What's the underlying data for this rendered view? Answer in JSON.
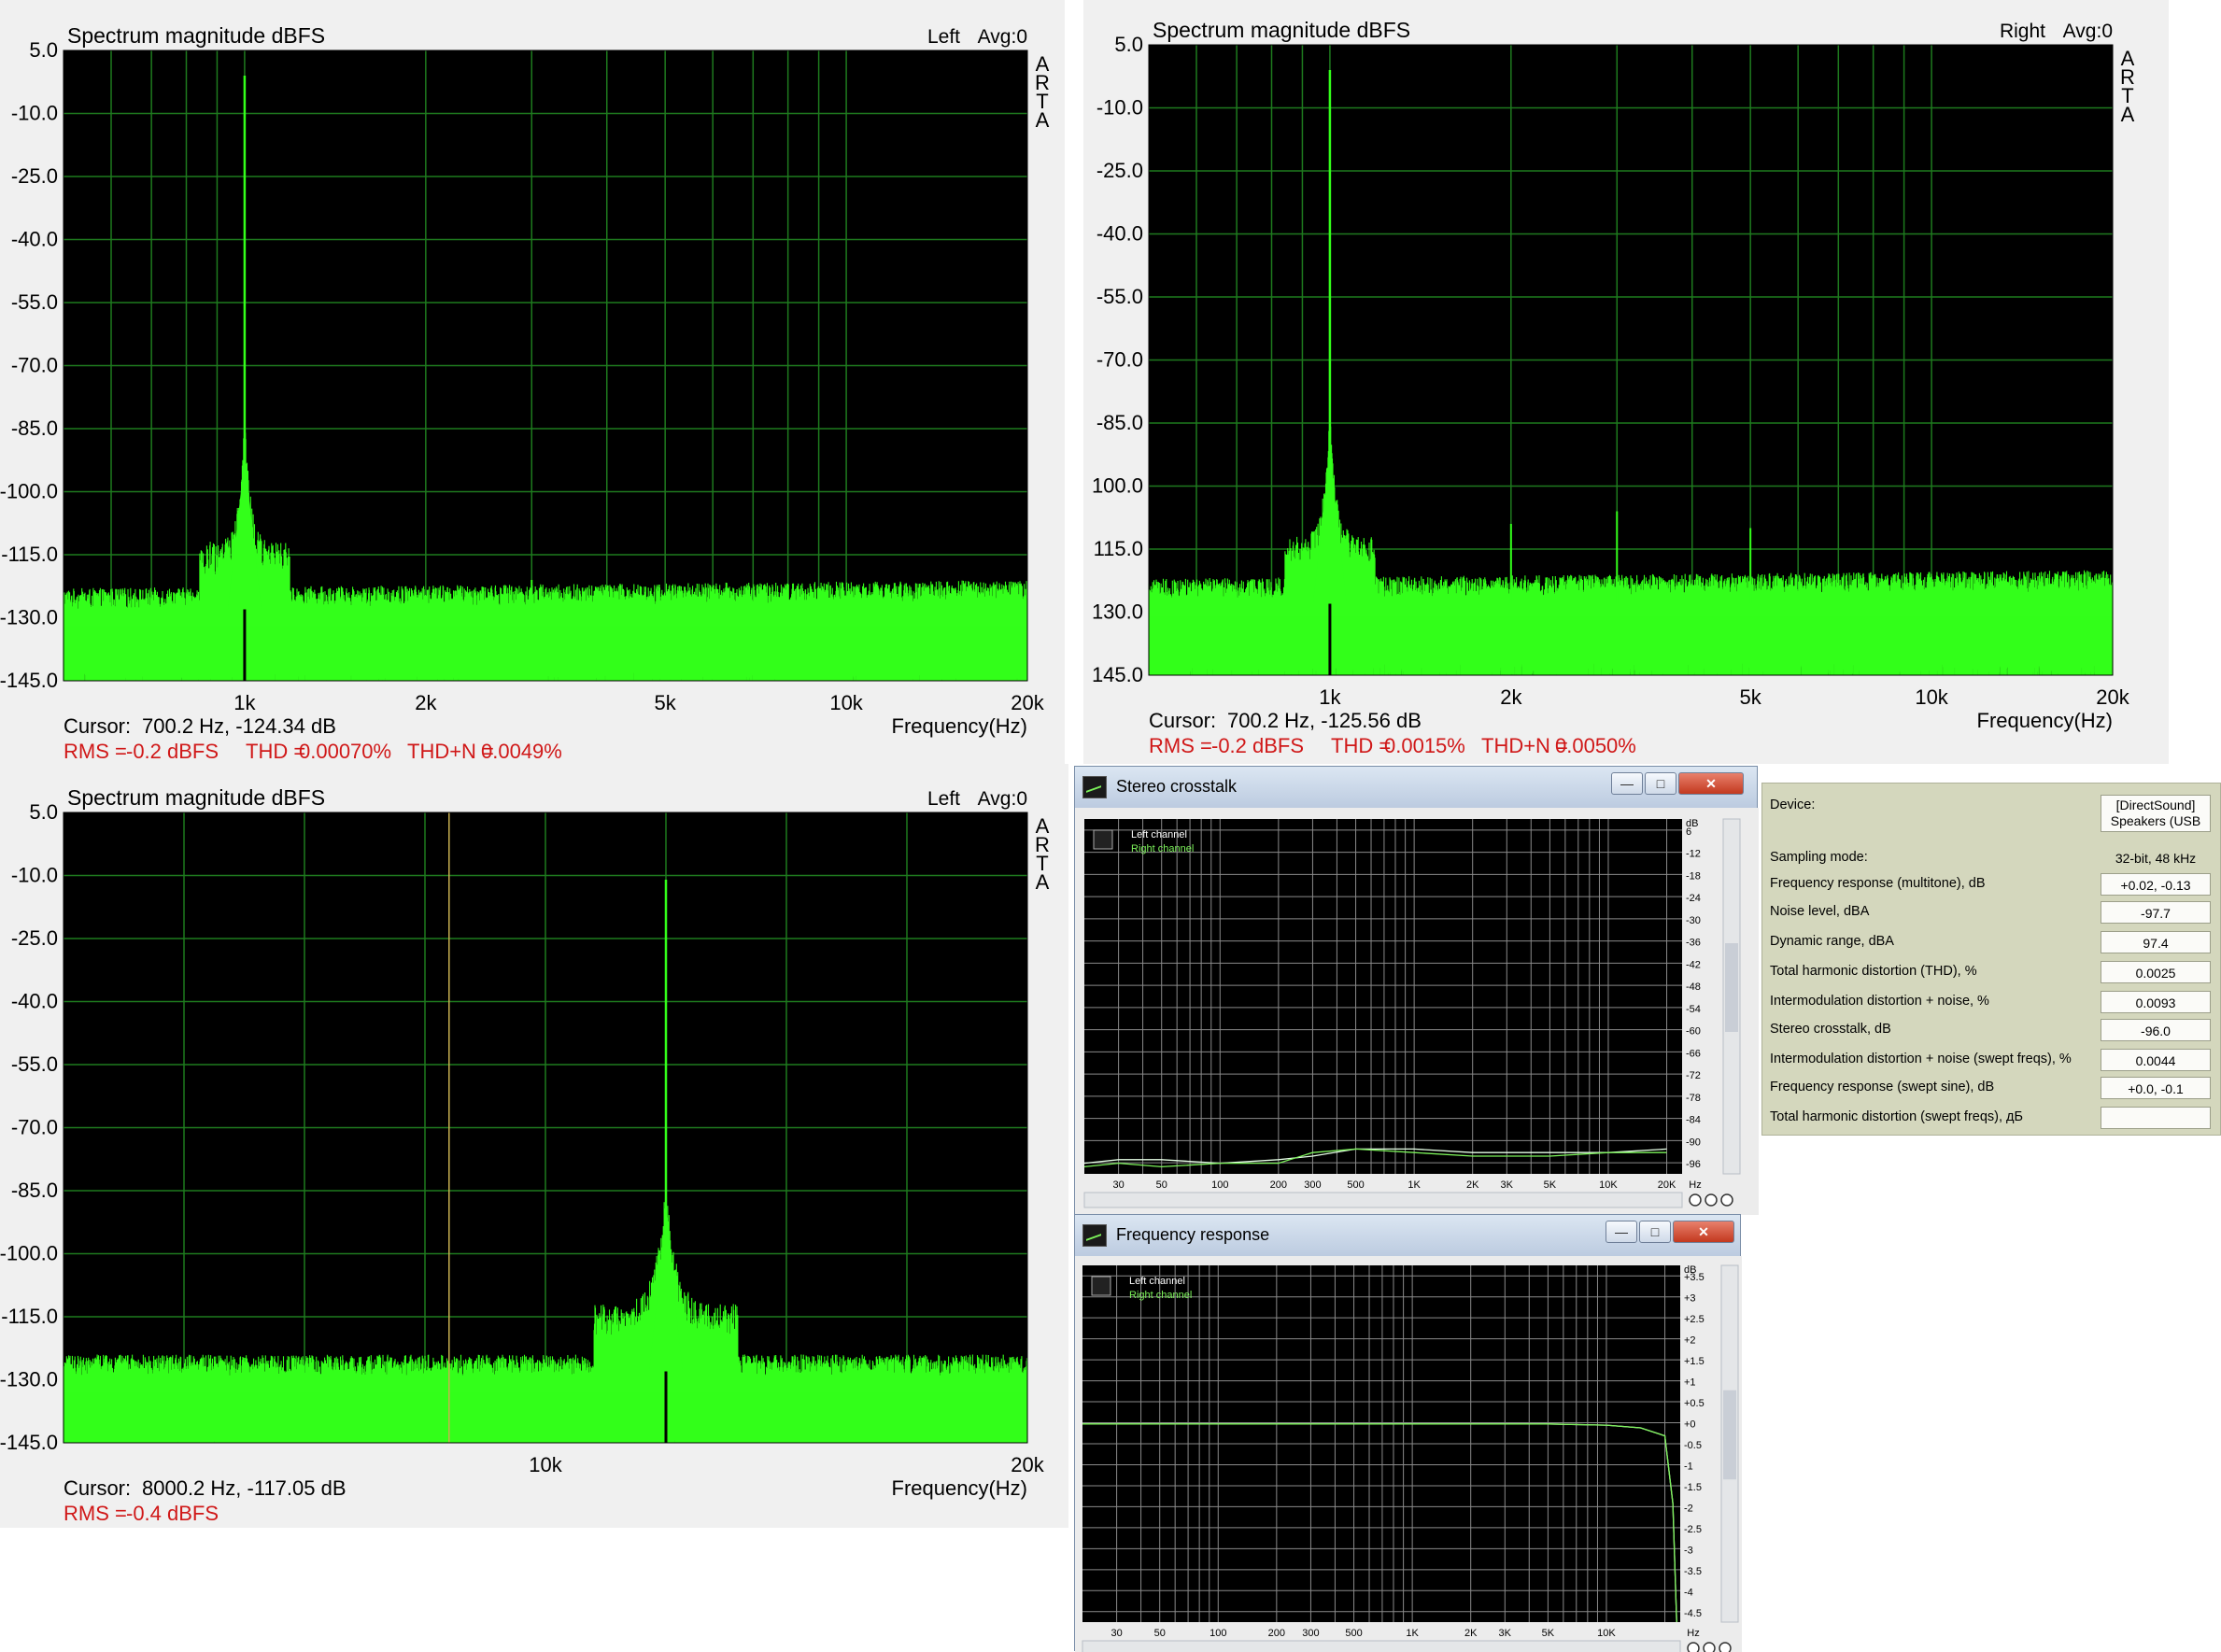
{
  "arta_panels": [
    {
      "title": "Spectrum magnitude dBFS",
      "channel": "Left",
      "avg": "Avg:0",
      "side_label": [
        "A",
        "R",
        "T",
        "A"
      ],
      "cursor_label": "Cursor:",
      "cursor_value": "700.2 Hz, -124.34 dB",
      "xlabel": "Frequency(Hz)",
      "stats": [
        {
          "label": "RMS =",
          "value": "-0.2 dBFS"
        },
        {
          "label": "THD =",
          "value": "0.00070%"
        },
        {
          "label": "THD+N =",
          "value": "0.0049%"
        }
      ]
    },
    {
      "title": "Spectrum magnitude dBFS",
      "channel": "Right",
      "avg": "Avg:0",
      "side_label": [
        "A",
        "R",
        "T",
        "A"
      ],
      "cursor_label": "Cursor:",
      "cursor_value": "700.2 Hz, -125.56 dB",
      "xlabel": "Frequency(Hz)",
      "stats": [
        {
          "label": "RMS =",
          "value": "-0.2 dBFS"
        },
        {
          "label": "THD =",
          "value": "0.0015%"
        },
        {
          "label": "THD+N =",
          "value": "0.0050%"
        }
      ]
    },
    {
      "title": "Spectrum magnitude dBFS",
      "channel": "Left",
      "avg": "Avg:0",
      "side_label": [
        "A",
        "R",
        "T",
        "A"
      ],
      "cursor_label": "Cursor:",
      "cursor_value": "8000.2 Hz, -117.05 dB",
      "xlabel": "Frequency(Hz)",
      "stats": [
        {
          "label": "RMS =",
          "value": "-0.4 dBFS"
        }
      ]
    }
  ],
  "windows": {
    "crosstalk": {
      "title": "Stereo crosstalk",
      "legend": [
        "Left channel",
        "Right channel"
      ],
      "xunit": "Hz",
      "yunit": "dB"
    },
    "freqresp": {
      "title": "Frequency response",
      "legend": [
        "Left channel",
        "Right channel"
      ],
      "xunit": "Hz",
      "yunit": "dB"
    }
  },
  "properties": {
    "rows": [
      {
        "label": "Device:",
        "value": "[DirectSound] Speakers (USB"
      },
      {
        "label": "Sampling mode:",
        "value": "32-bit, 48 kHz"
      },
      {
        "label": "Frequency response (multitone), dB",
        "value": "+0.02, -0.13"
      },
      {
        "label": "Noise level, dBA",
        "value": "-97.7"
      },
      {
        "label": "Dynamic range, dBA",
        "value": "97.4"
      },
      {
        "label": "Total harmonic distortion (THD), %",
        "value": "0.0025"
      },
      {
        "label": "Intermodulation distortion + noise, %",
        "value": "0.0093"
      },
      {
        "label": "Stereo crosstalk, dB",
        "value": "-96.0"
      },
      {
        "label": "Intermodulation distortion + noise (swept freqs), %",
        "value": "0.0044"
      },
      {
        "label": "Frequency response (swept sine), dB",
        "value": "+0.0, -0.1"
      },
      {
        "label": "Total harmonic distortion (swept freqs), дБ",
        "value": ""
      }
    ]
  },
  "colors": {
    "trace": "#33ff1a",
    "grid": "#1e7a1e",
    "stats": "#d01818",
    "plot_bg": "#000000",
    "panel_bg": "#f0f0f0"
  },
  "chart_data": [
    {
      "type": "line",
      "title": "Spectrum magnitude dBFS",
      "xlabel": "Frequency(Hz)",
      "x_scale": "log",
      "xlim": [
        500,
        20000
      ],
      "ylim": [
        -145,
        5
      ],
      "yticks": [
        "5.0",
        "-10.0",
        "-25.0",
        "-40.0",
        "-55.0",
        "-70.0",
        "-85.0",
        "-100.0",
        "-115.0",
        "-130.0",
        "-145.0"
      ],
      "xticks": [
        {
          "v": 1000,
          "label": "1k"
        },
        {
          "v": 2000,
          "label": "2k"
        },
        {
          "v": 5000,
          "label": "5k"
        },
        {
          "v": 10000,
          "label": "10k"
        },
        {
          "v": 20000,
          "label": "20k"
        }
      ],
      "grid": true,
      "fundamental_hz": 1000,
      "fundamental_db": -1,
      "noise_floor_db": [
        -133,
        -125
      ],
      "harmonics": [
        {
          "x": 3000,
          "y": -121
        }
      ],
      "series": [
        {
          "values": "FFT spectrum, 1 kHz tone"
        }
      ]
    },
    {
      "type": "line",
      "title": "Spectrum magnitude dBFS",
      "xlabel": "Frequency(Hz)",
      "x_scale": "log",
      "xlim": [
        500,
        20000
      ],
      "ylim": [
        -145,
        5
      ],
      "yticks": [
        "5.0",
        "-10.0",
        "-25.0",
        "-40.0",
        "-55.0",
        "-70.0",
        "-85.0",
        "100.0",
        "115.0",
        "130.0",
        "145.0"
      ],
      "xticks": [
        {
          "v": 1000,
          "label": "1k"
        },
        {
          "v": 2000,
          "label": "2k"
        },
        {
          "v": 5000,
          "label": "5k"
        },
        {
          "v": 10000,
          "label": "10k"
        },
        {
          "v": 20000,
          "label": "20k"
        }
      ],
      "grid": true,
      "fundamental_hz": 1000,
      "fundamental_db": -1,
      "noise_floor_db": [
        -132,
        -124
      ],
      "harmonics": [
        {
          "x": 2000,
          "y": -109
        },
        {
          "x": 3000,
          "y": -106
        },
        {
          "x": 5000,
          "y": -110
        }
      ],
      "series": [
        {
          "values": "FFT spectrum, 1 kHz tone"
        }
      ]
    },
    {
      "type": "line",
      "title": "Spectrum magnitude dBFS",
      "xlabel": "Frequency(Hz)",
      "x_scale": "linear",
      "xlim": [
        0,
        20000
      ],
      "ylim": [
        -145,
        5
      ],
      "yticks": [
        "5.0",
        "-10.0",
        "-25.0",
        "-40.0",
        "-55.0",
        "-70.0",
        "-85.0",
        "-100.0",
        "-115.0",
        "-130.0",
        "-145.0"
      ],
      "xticks": [
        {
          "v": 10000,
          "label": "10k"
        },
        {
          "v": 20000,
          "label": "20k"
        }
      ],
      "cursor_hz": 8000,
      "grid": true,
      "fundamental_hz": 12500,
      "fundamental_db": -11,
      "noise_floor_db": [
        -134,
        -126
      ],
      "series": [
        {
          "values": "FFT spectrum, high-frequency tone"
        }
      ]
    },
    {
      "type": "line",
      "title": "Stereo crosstalk",
      "x_scale": "log",
      "xlim": [
        20,
        24000
      ],
      "ylim": [
        -100,
        0
      ],
      "yticks": [
        "6",
        "-12",
        "-18",
        "-24",
        "-30",
        "-36",
        "-42",
        "-48",
        "-54",
        "-60",
        "-66",
        "-72",
        "-78",
        "-84",
        "-90",
        "-96"
      ],
      "xticks": [
        "30",
        "50",
        "100",
        "200",
        "300",
        "500",
        "1K",
        "2K",
        "3K",
        "5K",
        "10K",
        "20K"
      ],
      "series": [
        {
          "name": "Left channel",
          "x": [
            20,
            30,
            50,
            100,
            200,
            300,
            500,
            1000,
            2000,
            5000,
            10000,
            20000
          ],
          "y": [
            -97,
            -96,
            -96,
            -97,
            -96,
            -95,
            -93,
            -93,
            -94,
            -94,
            -94,
            -93
          ]
        },
        {
          "name": "Right channel",
          "x": [
            20,
            30,
            50,
            100,
            200,
            300,
            500,
            1000,
            2000,
            5000,
            10000,
            20000
          ],
          "y": [
            -98,
            -97,
            -98,
            -97,
            -97,
            -94,
            -93,
            -94,
            -95,
            -95,
            -94,
            -94
          ]
        }
      ]
    },
    {
      "type": "line",
      "title": "Frequency response",
      "x_scale": "log",
      "xlim": [
        20,
        24000
      ],
      "ylim": [
        -5,
        4
      ],
      "yticks": [
        "+3.5",
        "+3",
        "+2.5",
        "+2",
        "+1.5",
        "+1",
        "+0.5",
        "+0",
        "-0.5",
        "-1",
        "-1.5",
        "-2",
        "-2.5",
        "-3",
        "-3.5",
        "-4",
        "-4.5"
      ],
      "xticks": [
        "30",
        "50",
        "100",
        "200",
        "300",
        "500",
        "1K",
        "2K",
        "3K",
        "5K",
        "10K"
      ],
      "series": [
        {
          "name": "Left channel",
          "x": [
            20,
            100,
            1000,
            5000,
            10000,
            15000,
            20000,
            22000,
            23000
          ],
          "y": [
            0.0,
            0.0,
            0.0,
            0.0,
            -0.03,
            -0.1,
            -0.3,
            -2,
            -5
          ]
        },
        {
          "name": "Right channel",
          "x": [
            20,
            100,
            1000,
            5000,
            10000,
            15000,
            20000,
            22000,
            23000
          ],
          "y": [
            0.0,
            0.0,
            0.0,
            0.0,
            -0.03,
            -0.1,
            -0.3,
            -2,
            -5
          ]
        }
      ]
    }
  ]
}
